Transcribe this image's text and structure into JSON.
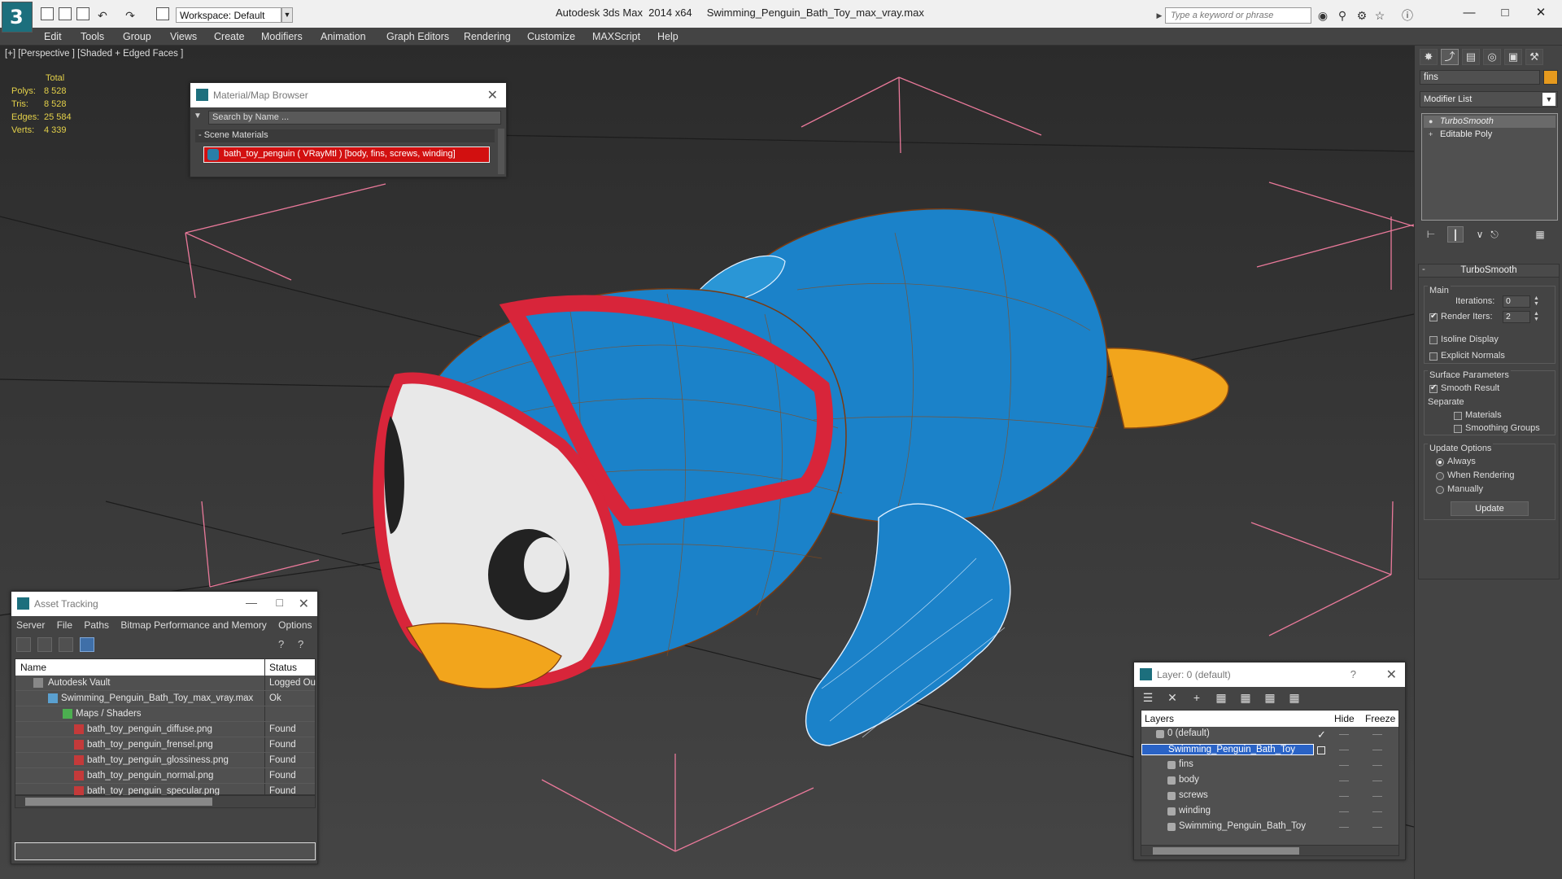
{
  "window": {
    "app_title": "Autodesk 3ds Max  2014 x64",
    "file_title": "Swimming_Penguin_Bath_Toy_max_vray.max",
    "workspace": "Workspace: Default",
    "search_placeholder": "Type a keyword or phrase"
  },
  "menu": [
    "Edit",
    "Tools",
    "Group",
    "Views",
    "Create",
    "Modifiers",
    "Animation",
    "Graph Editors",
    "Rendering",
    "Customize",
    "MAXScript",
    "Help"
  ],
  "viewport": {
    "label": "[+] [Perspective ] [Shaded + Edged Faces ]",
    "stats": {
      "header": "Total",
      "rows": [
        {
          "label": "Polys:",
          "value": "8 528"
        },
        {
          "label": "Tris:",
          "value": "8 528"
        },
        {
          "label": "Edges:",
          "value": "25 584"
        },
        {
          "label": "Verts:",
          "value": "4 339"
        }
      ]
    }
  },
  "material_browser": {
    "title": "Material/Map Browser",
    "search_placeholder": "Search by Name ...",
    "section": "- Scene Materials",
    "material": "bath_toy_penguin  ( VRayMtl ) [body, fins, screws, winding]"
  },
  "asset_tracking": {
    "title": "Asset Tracking",
    "menu": [
      "Server",
      "File",
      "Paths",
      "Bitmap Performance and Memory",
      "Options"
    ],
    "columns": {
      "name": "Name",
      "status": "Status"
    },
    "rows": [
      {
        "name": "Autodesk Vault",
        "status": "Logged Ou"
      },
      {
        "name": "Swimming_Penguin_Bath_Toy_max_vray.max",
        "status": "Ok"
      },
      {
        "name": "Maps / Shaders",
        "status": ""
      },
      {
        "name": "bath_toy_penguin_diffuse.png",
        "status": "Found"
      },
      {
        "name": "bath_toy_penguin_frensel.png",
        "status": "Found"
      },
      {
        "name": "bath_toy_penguin_glossiness.png",
        "status": "Found"
      },
      {
        "name": "bath_toy_penguin_normal.png",
        "status": "Found"
      },
      {
        "name": "bath_toy_penguin_specular.png",
        "status": "Found"
      }
    ]
  },
  "layer_panel": {
    "title": "Layer: 0 (default)",
    "help": "?",
    "columns": {
      "layers": "Layers",
      "hide": "Hide",
      "freeze": "Freeze"
    },
    "rows": [
      {
        "name": "0 (default)"
      },
      {
        "name": "Swimming_Penguin_Bath_Toy"
      },
      {
        "name": "fins"
      },
      {
        "name": "body"
      },
      {
        "name": "screws"
      },
      {
        "name": "winding"
      },
      {
        "name": "Swimming_Penguin_Bath_Toy"
      }
    ]
  },
  "command_panel": {
    "object_name": "fins",
    "object_color": "#e69a1e",
    "modifier_list": "Modifier List",
    "stack": [
      "TurboSmooth",
      "Editable Poly"
    ],
    "rollout_title": "TurboSmooth",
    "main_group": "Main",
    "iterations_label": "Iterations:",
    "iterations_value": "0",
    "render_iters_label": "Render Iters:",
    "render_iters_value": "2",
    "isoline": "Isoline Display",
    "explicit_normals": "Explicit Normals",
    "surface_group": "Surface Parameters",
    "smooth_result": "Smooth Result",
    "separate": "Separate",
    "materials": "Materials",
    "smoothing_groups": "Smoothing Groups",
    "update_group": "Update Options",
    "always": "Always",
    "when_rendering": "When Rendering",
    "manually": "Manually",
    "update_button": "Update"
  },
  "colors": {
    "penguin_body": "#1b82c9",
    "goggle_red": "#d8253a",
    "tail_orange": "#f2a51c",
    "selection_bracket": "#e9799a"
  }
}
